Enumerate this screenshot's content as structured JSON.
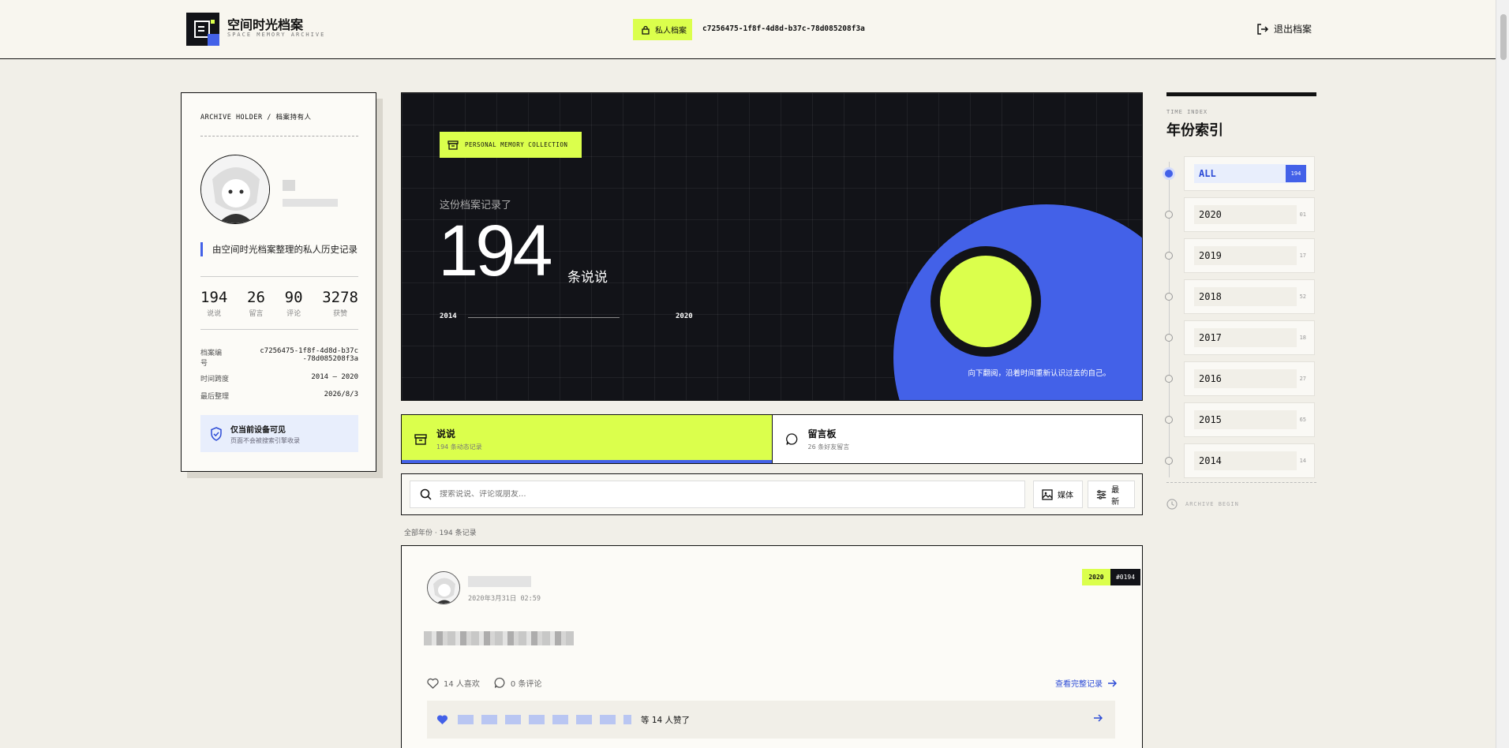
{
  "header": {
    "brand_title": "空间时光档案",
    "brand_subtitle": "SPACE MEMORY ARCHIVE",
    "private_label": "私人档案",
    "archive_id": "c7256475-1f8f-4d8d-b37c-78d085208f3a",
    "logout_label": "退出档案"
  },
  "holder": {
    "head": "ARCHIVE HOLDER / 档案持有人",
    "quote": "由空间时光档案整理的私人历史记录",
    "stats": [
      {
        "num": "194",
        "label": "说说"
      },
      {
        "num": "26",
        "label": "留言"
      },
      {
        "num": "90",
        "label": "评论"
      },
      {
        "num": "3278",
        "label": "获赞"
      }
    ],
    "info": [
      {
        "key": "档案编号",
        "value": "c7256475-1f8f-4d8d-b37c-78d085208f3a"
      },
      {
        "key": "时间跨度",
        "value": "2014 — 2020"
      },
      {
        "key": "最后整理",
        "value": "2026/8/3"
      }
    ],
    "privacy_title": "仅当前设备可见",
    "privacy_sub": "页面不会被搜索引擎收录"
  },
  "hero": {
    "tag": "PERSONAL MEMORY COLLECTION",
    "intro": "这份档案记录了",
    "count": "194",
    "unit": "条说说",
    "year_start": "2014",
    "year_end": "2020",
    "caption": "向下翻阅，沿着时间重新认识过去的自己。"
  },
  "tabs": [
    {
      "label": "说说",
      "sub": "194 条动态记录"
    },
    {
      "label": "留言板",
      "sub": "26 条好友留言"
    }
  ],
  "search": {
    "placeholder": "搜索说说、评论或朋友...",
    "media_label": "媒体",
    "sort_label": "最新"
  },
  "result_count": "全部年份 · 194 条记录",
  "post": {
    "time": "2020年3月31日 02:59",
    "year": "2020",
    "id": "#0194",
    "likes": "14 人喜欢",
    "comments": "0 条评论",
    "more": "查看完整记录",
    "liked_by_suffix": "等 14 人赞了"
  },
  "time_index": {
    "label": "TIME INDEX",
    "title": "年份索引",
    "items": [
      {
        "year": "ALL",
        "count": "194"
      },
      {
        "year": "2020",
        "count": "01"
      },
      {
        "year": "2019",
        "count": "17"
      },
      {
        "year": "2018",
        "count": "52"
      },
      {
        "year": "2017",
        "count": "18"
      },
      {
        "year": "2016",
        "count": "27"
      },
      {
        "year": "2015",
        "count": "65"
      },
      {
        "year": "2014",
        "count": "14"
      }
    ],
    "begin": "ARCHIVE BEGIN"
  },
  "colors": {
    "accent_lime": "#dbff4c",
    "accent_blue": "#4361e8",
    "dark": "#121318"
  }
}
